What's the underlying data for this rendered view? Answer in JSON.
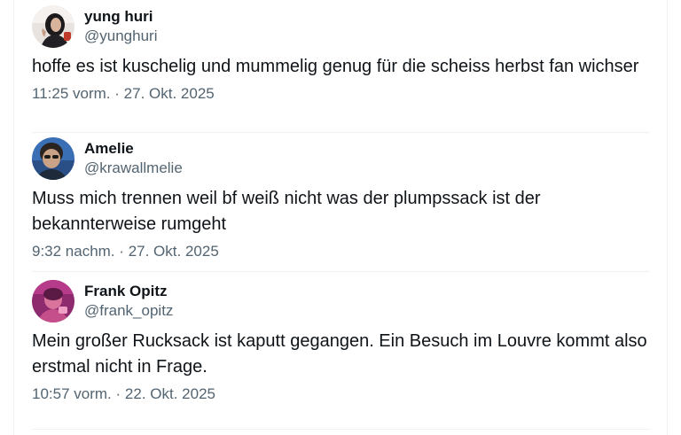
{
  "tweets": [
    {
      "display_name": "yung huri",
      "handle": "@yunghuri",
      "text": "hoffe es ist kuschelig und mummelig genug für die scheiss herbst fan wichser",
      "time": "11:25 vorm.",
      "separator": "·",
      "date": "27. Okt. 2025",
      "avatar_icon": "avatar-photo-dark-hair"
    },
    {
      "display_name": "Amelie",
      "handle": "@krawallmelie",
      "text": "Muss mich trennen weil bf weiß nicht was der plumpssack ist der bekannterweise rumgeht",
      "time": "9:32 nachm.",
      "separator": "·",
      "date": "27. Okt. 2025",
      "avatar_icon": "avatar-photo-face-blue"
    },
    {
      "display_name": "Frank Opitz",
      "handle": "@frank_opitz",
      "text": "Mein großer Rucksack ist kaputt gegangen. Ein Besuch im Louvre kommt also erstmal nicht in Frage.",
      "time": "10:57 vorm.",
      "separator": "·",
      "date": "22. Okt. 2025",
      "avatar_icon": "avatar-photo-pink"
    }
  ],
  "colors": {
    "text": "#0f1419",
    "secondary": "#536471",
    "divider": "#eff3f4"
  }
}
